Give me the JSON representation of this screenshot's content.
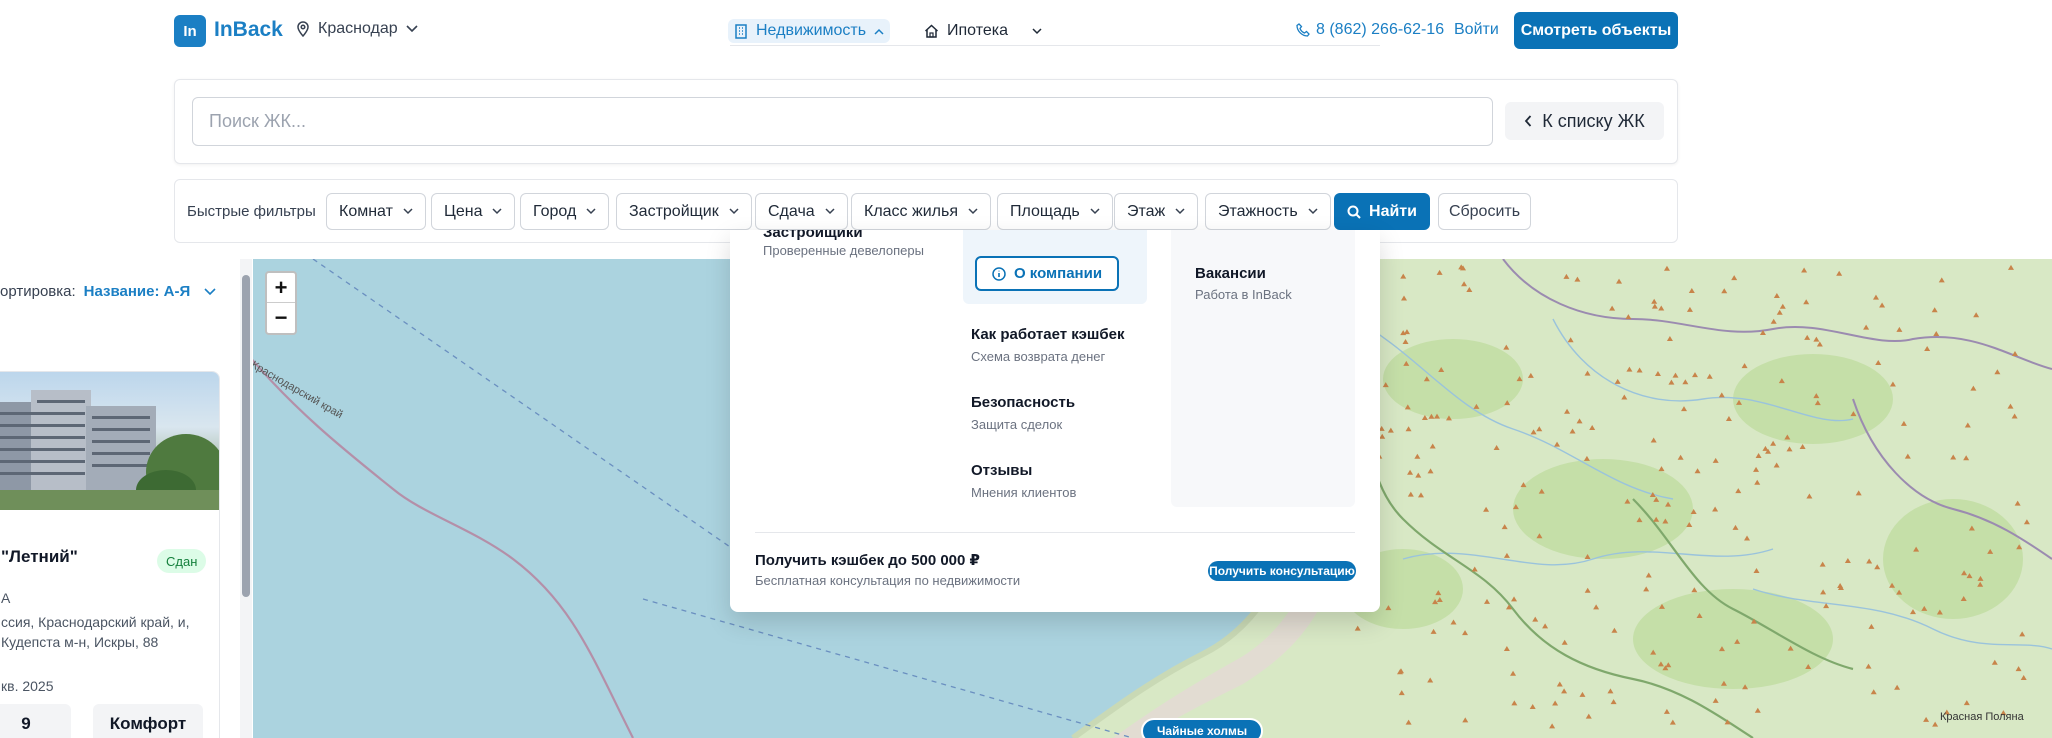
{
  "header": {
    "logo_mark": "In",
    "logo_text": "InBack",
    "city": "Краснодар",
    "nav": [
      {
        "label": "Недвижимость",
        "icon": "building-icon",
        "active": true
      },
      {
        "label": "Ипотека",
        "icon": "home-icon",
        "active": false
      }
    ],
    "phone": "8 (862) 266-62-16",
    "login": "Войти",
    "cta": "Смотреть объекты"
  },
  "search": {
    "placeholder": "Поиск ЖК...",
    "back_label": "К списку ЖК"
  },
  "filters": {
    "quick_label": "Быстрые фильтры",
    "chips": [
      "Комнат",
      "Цена",
      "Город",
      "Застройщик",
      "Сдача",
      "Класс жилья",
      "Площадь",
      "Этаж",
      "Этажность"
    ],
    "find_label": "Найти",
    "reset_label": "Сбросить"
  },
  "list": {
    "sort_label": "ортировка:",
    "sort_value": "Название: А-Я",
    "card": {
      "title": " \"Летний\"",
      "badge": "Сдан",
      "developer": "A",
      "address": "ссия, Краснодарский край, и, Кудепста м-н, Искры, 88",
      "date": "кв. 2025",
      "stat_1": "9",
      "stat_2": "Комфорт"
    }
  },
  "menu": {
    "col1": {
      "title": "Застройщики",
      "sub": "Проверенные девелоперы"
    },
    "about_button": "О компании",
    "items": [
      {
        "title": "Как работает кэшбек",
        "sub": "Схема возврата денег"
      },
      {
        "title": "Безопасность",
        "sub": "Защита сделок"
      },
      {
        "title": "Отзывы",
        "sub": "Мнения клиентов"
      }
    ],
    "col3": {
      "title": "Вакансии",
      "sub": "Работа в InBack"
    },
    "footer": {
      "title": "Получить кэшбек до 500 000 ₽",
      "sub": "Бесплатная консультация по недвижимости",
      "button": "Получить консультацию"
    }
  },
  "map": {
    "zoom_in": "+",
    "zoom_out": "−",
    "region_label": "Краснодарский край",
    "place_label": "Красная Поляна",
    "pin_label": "Чайные холмы"
  },
  "colors": {
    "brand": "#1b7fc4",
    "button": "#0a72b6",
    "sea": "#abd3df",
    "land": "#d8e8c5",
    "success_bg": "#dcfce7",
    "success_text": "#15803d"
  }
}
